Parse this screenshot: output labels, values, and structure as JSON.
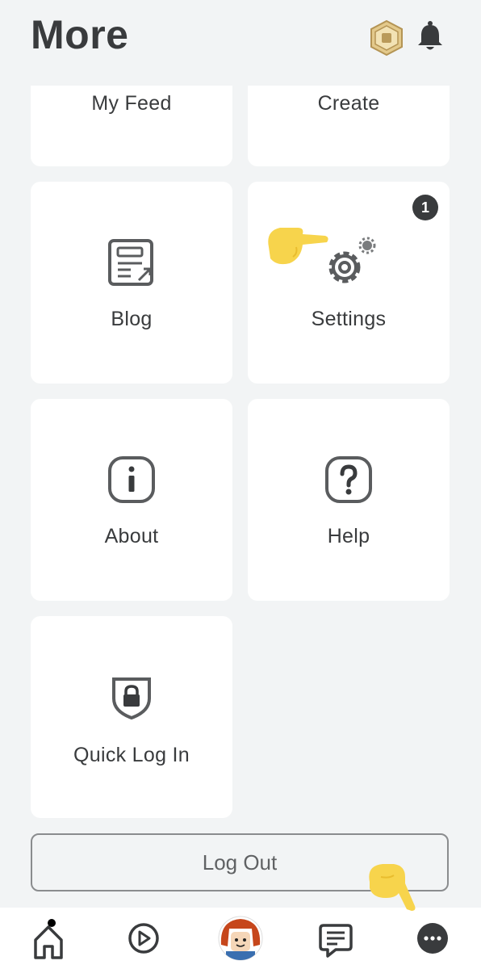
{
  "header": {
    "title": "More"
  },
  "tiles": {
    "my_feed": "My Feed",
    "create": "Create",
    "blog": "Blog",
    "settings": "Settings",
    "settings_badge": "1",
    "about": "About",
    "help": "Help",
    "quick_log_in": "Quick Log In"
  },
  "logout": {
    "label": "Log Out"
  },
  "icons": {
    "robux": "robux-icon",
    "notifications": "bell-icon",
    "blog": "blog-icon",
    "settings": "gear-icon",
    "about": "info-icon",
    "help": "help-icon",
    "quick_log_in": "shield-lock-icon",
    "pointer": "pointing-hand-icon",
    "nav_home": "home-icon",
    "nav_discover": "play-icon",
    "nav_avatar": "avatar-icon",
    "nav_chat": "chat-icon",
    "nav_more": "more-icon"
  },
  "colors": {
    "background": "#f2f4f5",
    "tile": "#ffffff",
    "text": "#393b3d",
    "badge": "#393b3d",
    "pointer_hand": "#f7d44c"
  }
}
